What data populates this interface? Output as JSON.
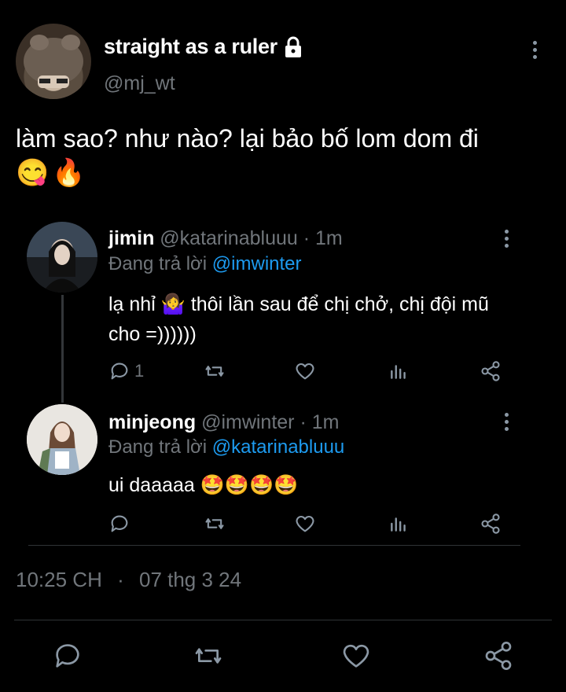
{
  "tweet": {
    "display_name": "straight as a ruler",
    "handle": "@mj_wt",
    "text": "làm sao? như nào? lại bảo bố lom dom đi",
    "emojis": "😋🔥",
    "timestamp": "10:25 CH",
    "separator": "·",
    "date": "07 thg 3 24"
  },
  "replies": [
    {
      "name": "jimin",
      "handle": "@katarinabluuu",
      "time": "1m",
      "replying_label": "Đang trả lời",
      "replying_to": "@imwinter",
      "text_part1": "lạ nhỉ",
      "emoji": "🤷‍♀️",
      "text_part2": "thôi lần sau để chị chở, chị đội mũ cho =))))))",
      "reply_count": "1"
    },
    {
      "name": "minjeong",
      "handle": "@imwinter",
      "time": "1m",
      "replying_label": "Đang trả lời",
      "replying_to": "@katarinabluuu",
      "text": "ui daaaaa",
      "emoji": "🤩🤩🤩🤩",
      "reply_count": ""
    }
  ],
  "icons": {
    "lock": "lock-icon",
    "more": "more-vertical-icon",
    "reply": "reply-icon",
    "retweet": "retweet-icon",
    "like": "heart-icon",
    "views": "views-icon",
    "share": "share-icon"
  },
  "colors": {
    "background": "#000000",
    "text": "#e7e9ea",
    "muted": "#71767b",
    "link": "#1d9bf0",
    "divider": "#2f3336"
  }
}
